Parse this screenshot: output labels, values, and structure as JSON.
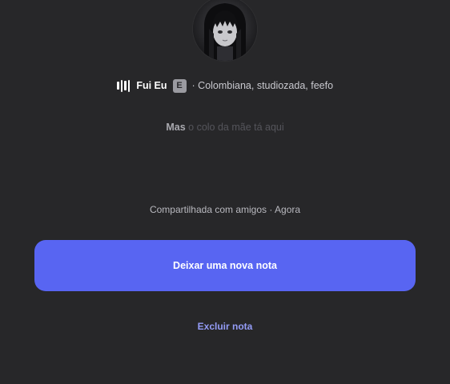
{
  "track": {
    "title": "Fui Eu",
    "explicit_badge": "E",
    "artists": "· Colombiana, studiozada, feefo"
  },
  "note": {
    "visible_text": "Mas",
    "faded_text": "o colo da mãe tá aqui"
  },
  "meta": {
    "shared_status": "Compartilhada com amigos · Agora"
  },
  "actions": {
    "new_note_label": "Deixar uma nova nota",
    "delete_note_label": "Excluir nota"
  },
  "icons": {
    "now_playing": "audio-bars-icon",
    "explicit": "explicit-badge"
  },
  "colors": {
    "background": "#272729",
    "accent": "#5865f2",
    "link": "#949cf7"
  }
}
